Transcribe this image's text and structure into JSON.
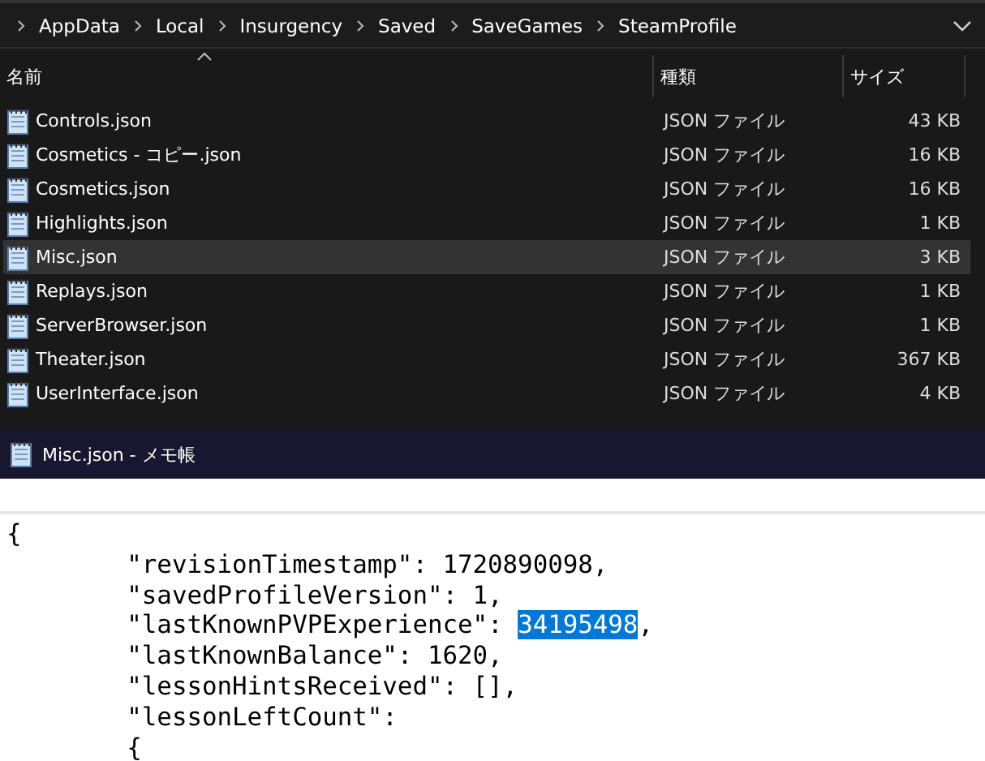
{
  "breadcrumb": [
    "AppData",
    "Local",
    "Insurgency",
    "Saved",
    "SaveGames",
    "SteamProfile"
  ],
  "table": {
    "columns": [
      "名前",
      "種類",
      "サイズ"
    ],
    "rows": [
      {
        "name": "Controls.json",
        "type": "JSON ファイル",
        "size": "43 KB",
        "selected": false
      },
      {
        "name": "Cosmetics - コピー.json",
        "type": "JSON ファイル",
        "size": "16 KB",
        "selected": false
      },
      {
        "name": "Cosmetics.json",
        "type": "JSON ファイル",
        "size": "16 KB",
        "selected": false
      },
      {
        "name": "Highlights.json",
        "type": "JSON ファイル",
        "size": "1 KB",
        "selected": false
      },
      {
        "name": "Misc.json",
        "type": "JSON ファイル",
        "size": "3 KB",
        "selected": true
      },
      {
        "name": "Replays.json",
        "type": "JSON ファイル",
        "size": "1 KB",
        "selected": false
      },
      {
        "name": "ServerBrowser.json",
        "type": "JSON ファイル",
        "size": "1 KB",
        "selected": false
      },
      {
        "name": "Theater.json",
        "type": "JSON ファイル",
        "size": "367 KB",
        "selected": false
      },
      {
        "name": "UserInterface.json",
        "type": "JSON ファイル",
        "size": "4 KB",
        "selected": false
      }
    ]
  },
  "notepad": {
    "title": "Misc.json - メモ帳",
    "lines": [
      [
        {
          "text": "{",
          "selected": false
        }
      ],
      [
        {
          "text": "\t\"revisionTimestamp\": 1720890098,",
          "selected": false
        }
      ],
      [
        {
          "text": "\t\"savedProfileVersion\": 1,",
          "selected": false
        }
      ],
      [
        {
          "text": "\t\"lastKnownPVPExperience\": ",
          "selected": false
        },
        {
          "text": "34195498",
          "selected": true
        },
        {
          "text": ",",
          "selected": false
        }
      ],
      [
        {
          "text": "\t\"lastKnownBalance\": 1620,",
          "selected": false
        }
      ],
      [
        {
          "text": "\t\"lessonHintsReceived\": [],",
          "selected": false
        }
      ],
      [
        {
          "text": "\t\"lessonLeftCount\":",
          "selected": false
        }
      ],
      [
        {
          "text": "\t{",
          "selected": false
        }
      ]
    ]
  }
}
